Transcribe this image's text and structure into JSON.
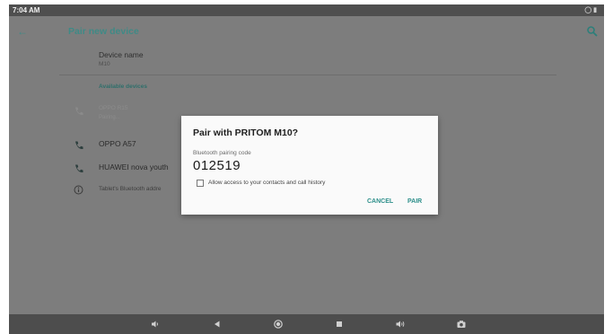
{
  "status_bar": {
    "time": "7:04 AM"
  },
  "app_bar": {
    "title": "Pair new device"
  },
  "device": {
    "name_label": "Device name",
    "name_value": "M10"
  },
  "available": {
    "header": "Available devices",
    "items": [
      {
        "title": "OPPO R15",
        "subtitle": "Pairing...",
        "faded": true
      },
      {
        "title": "OPPO A57",
        "subtitle": ""
      },
      {
        "title": "HUAWEI nova youth",
        "subtitle": ""
      }
    ],
    "info_text": "Tablet's Bluetooth addre"
  },
  "dialog": {
    "title": "Pair with PRITOM M10?",
    "code_label": "Bluetooth pairing code",
    "code": "012519",
    "checkbox_label": "Allow access to your contacts and call history",
    "checkbox_checked": false,
    "cancel_label": "CANCEL",
    "pair_label": "PAIR"
  },
  "colors": {
    "accent": "#2d8f8a",
    "scrim": "#7d7d7d",
    "status_bar": "#4f4f4f",
    "nav_bar": "#4d4d4d"
  }
}
